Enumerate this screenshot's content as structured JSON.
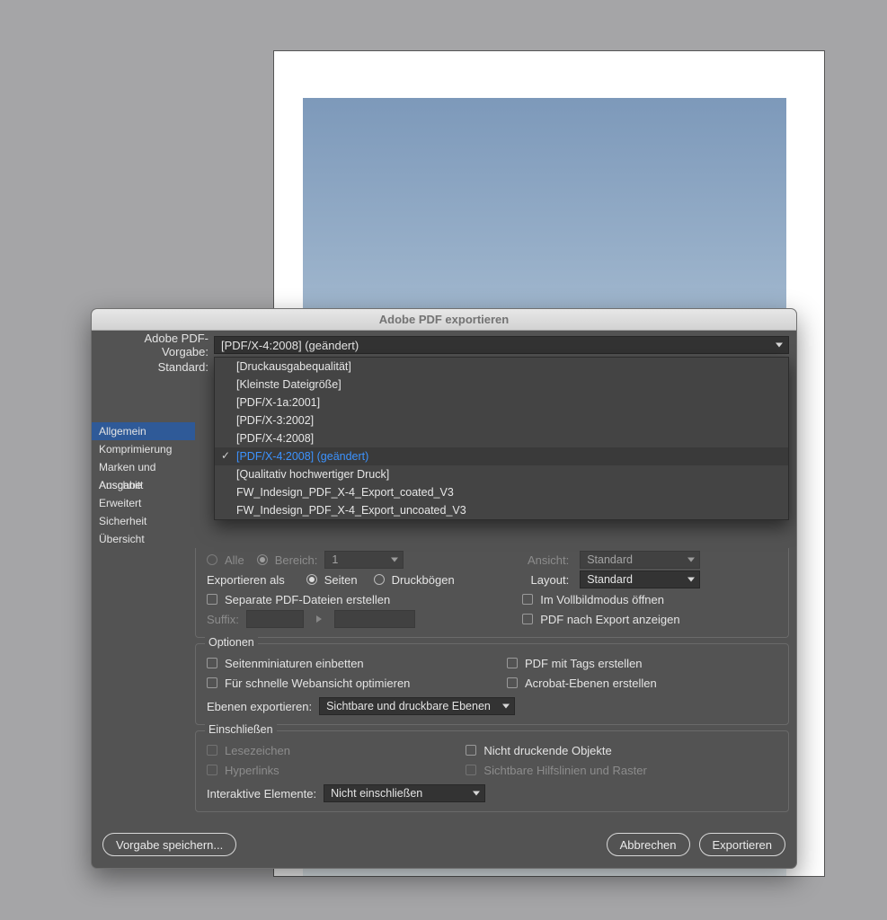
{
  "dialog_title": "Adobe PDF exportieren",
  "labels": {
    "preset": "Adobe PDF-Vorgabe:",
    "standard": "Standard:"
  },
  "preset_selected": "[PDF/X-4:2008] (geändert)",
  "preset_options": [
    "[Druckausgabequalität]",
    "[Kleinste Dateigröße]",
    "[PDF/X-1a:2001]",
    "[PDF/X-3:2002]",
    "[PDF/X-4:2008]",
    "[PDF/X-4:2008] (geändert)",
    "[Qualitativ hochwertiger Druck]",
    "FW_Indesign_PDF_X-4_Export_coated_V3",
    "FW_Indesign_PDF_X-4_Export_uncoated_V3"
  ],
  "preset_options_selected_index": 5,
  "sidebar": [
    "Allgemein",
    "Komprimierung",
    "Marken und Anschnitt",
    "Ausgabe",
    "Erweitert",
    "Sicherheit",
    "Übersicht"
  ],
  "sidebar_active_index": 0,
  "pages": {
    "radios": {
      "all": "Alle",
      "range": "Bereich:",
      "range_value": "1"
    },
    "export_as_label": "Exportieren als",
    "seiten": "Seiten",
    "druckbogen": "Druckbögen",
    "separate": "Separate PDF-Dateien erstellen",
    "suffix_label": "Suffix:"
  },
  "view": {
    "ansicht_lbl": "Ansicht:",
    "ansicht_val": "Standard",
    "layout_lbl": "Layout:",
    "layout_val": "Standard",
    "fullscreen": "Im Vollbildmodus öffnen",
    "after_export": "PDF nach Export anzeigen"
  },
  "options": {
    "legend": "Optionen",
    "thumbs": "Seitenminiaturen einbetten",
    "tagged": "PDF mit Tags erstellen",
    "fastweb": "Für schnelle Webansicht optimieren",
    "layers": "Acrobat-Ebenen erstellen",
    "export_layers_label": "Ebenen exportieren:",
    "export_layers_value": "Sichtbare und druckbare Ebenen"
  },
  "include": {
    "legend": "Einschließen",
    "bookmarks": "Lesezeichen",
    "nonprint": "Nicht druckende Objekte",
    "hyperlinks": "Hyperlinks",
    "guides": "Sichtbare Hilfslinien und Raster",
    "interactive_label": "Interaktive Elemente:",
    "interactive_value": "Nicht einschließen"
  },
  "footer": {
    "save_preset": "Vorgabe speichern...",
    "cancel": "Abbrechen",
    "export": "Exportieren"
  }
}
